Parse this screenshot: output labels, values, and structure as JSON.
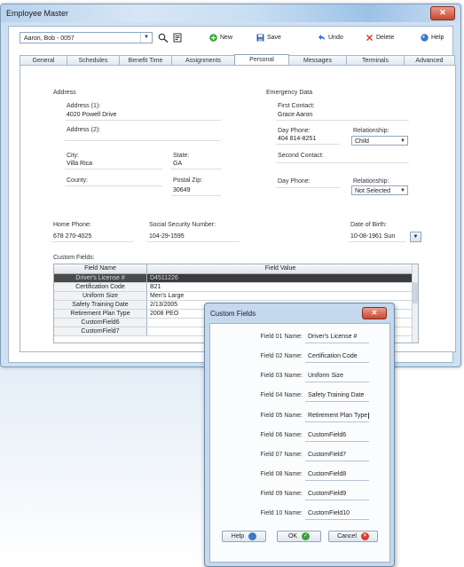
{
  "window": {
    "title": "Employee Master",
    "close_glyph": "✕"
  },
  "toolbar": {
    "employee_selected": "Aaron, Bob - 0057",
    "new_label": "New",
    "save_label": "Save",
    "undo_label": "Undo",
    "delete_label": "Delete",
    "help_label": "Help"
  },
  "tabs": [
    "General",
    "Schedules",
    "Benefit Time",
    "Assignments",
    "Personal",
    "Messages",
    "Terminals",
    "Advanced"
  ],
  "active_tab": "Personal",
  "address": {
    "section_label": "Address",
    "address1_label": "Address (1):",
    "address1_value": "4020 Powell Drive",
    "address2_label": "Address (2):",
    "city_label": "City:",
    "city_value": "Villa Rica",
    "state_label": "State:",
    "state_value": "GA",
    "county_label": "County:",
    "postal_label": "Postal Zip:",
    "postal_value": "30649"
  },
  "emergency": {
    "section_label": "Emergency Data",
    "first_contact_label": "First Contact:",
    "first_contact_value": "Grace Aaron",
    "day_phone_label": "Day Phone:",
    "day_phone_value": "404 814-8251",
    "relationship_label": "Relationship:",
    "relationship_value": "Child",
    "second_contact_label": "Second Contact:",
    "day_phone2_label": "Day Phone:",
    "relationship2_label": "Relationship:",
    "relationship2_value": "Not Selected"
  },
  "personal": {
    "home_phone_label": "Home Phone:",
    "home_phone_value": "678 270-4025",
    "ssn_label": "Social Security Number:",
    "ssn_value": "104-29-1595",
    "dob_label": "Date of Birth:",
    "dob_value": "10-08-1961 Sun"
  },
  "custom_fields_grid": {
    "section_label": "Custom Fields:",
    "col_name": "Field Name",
    "col_value": "Field Value",
    "rows": [
      {
        "name": "Driver's License #",
        "value": "D4511226",
        "selected": true
      },
      {
        "name": "Certification Code",
        "value": "B21"
      },
      {
        "name": "Uniform Size",
        "value": "Men's Large"
      },
      {
        "name": "Safety Training Date",
        "value": "2/13/2005"
      },
      {
        "name": "Retirement Plan Type",
        "value": "2008 PEO"
      },
      {
        "name": "CustomField6",
        "value": ""
      },
      {
        "name": "CustomField7",
        "value": ""
      }
    ]
  },
  "dialog": {
    "title": "Custom Fields",
    "close_glyph": "✕",
    "fields": [
      {
        "label": "Field 01 Name:",
        "value": "Driver's License #"
      },
      {
        "label": "Field 02 Name:",
        "value": "Certification Code"
      },
      {
        "label": "Field 03 Name:",
        "value": "Uniform Size"
      },
      {
        "label": "Field 04 Name:",
        "value": "Safety Training Date"
      },
      {
        "label": "Field 05 Name:",
        "value": "Retirement Plan Type"
      },
      {
        "label": "Field 06 Name:",
        "value": "CustomField6"
      },
      {
        "label": "Field 07 Name:",
        "value": "CustomField7"
      },
      {
        "label": "Field 08 Name:",
        "value": "CustomField8"
      },
      {
        "label": "Field 09 Name:",
        "value": "CustomField9"
      },
      {
        "label": "Field 10 Name:",
        "value": "CustomField10"
      }
    ],
    "help_label": "Help",
    "ok_label": "OK",
    "cancel_label": "Cancel"
  },
  "colors": {
    "ok_green": "#3aa23a",
    "cancel_red": "#d63a2a",
    "help_blue": "#3d78c9",
    "selected_row": "#3c3c3c"
  }
}
